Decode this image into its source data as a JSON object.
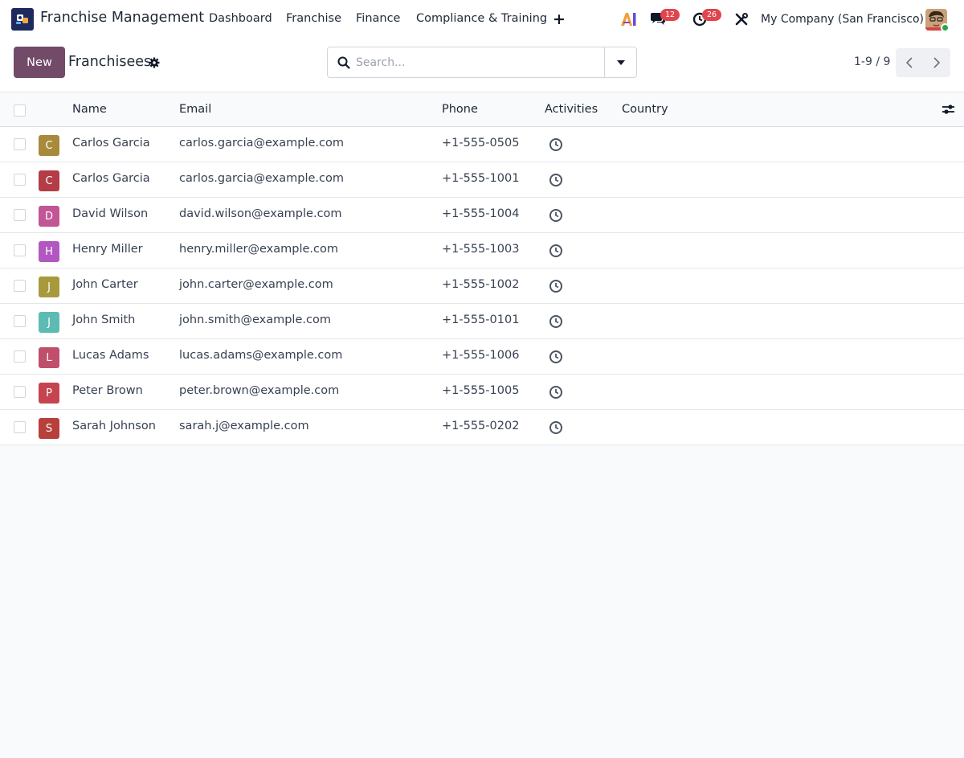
{
  "app": {
    "title": "Franchise Management"
  },
  "menu": [
    {
      "label": "Dashboard"
    },
    {
      "label": "Franchise"
    },
    {
      "label": "Finance"
    },
    {
      "label": "Compliance & Training"
    }
  ],
  "systray": {
    "ai_label": "AI",
    "messages_count": "12",
    "activities_count": "26",
    "company": "My Company (San Francisco)"
  },
  "control": {
    "new_label": "New",
    "title": "Franchisees",
    "search_placeholder": "Search...",
    "pager": "1-9 / 9"
  },
  "table": {
    "headers": {
      "name": "Name",
      "email": "Email",
      "phone": "Phone",
      "activities": "Activities",
      "country": "Country"
    },
    "rows": [
      {
        "initial": "C",
        "color": "#a78b3a",
        "name": "Carlos Garcia",
        "email": "carlos.garcia@example.com",
        "phone": "+1-555-0505"
      },
      {
        "initial": "C",
        "color": "#b43c46",
        "name": "Carlos Garcia",
        "email": "carlos.garcia@example.com",
        "phone": "+1-555-1001"
      },
      {
        "initial": "D",
        "color": "#c25595",
        "name": "David Wilson",
        "email": "david.wilson@example.com",
        "phone": "+1-555-1004"
      },
      {
        "initial": "H",
        "color": "#b257c1",
        "name": "Henry Miller",
        "email": "henry.miller@example.com",
        "phone": "+1-555-1003"
      },
      {
        "initial": "J",
        "color": "#a89a3c",
        "name": "John Carter",
        "email": "john.carter@example.com",
        "phone": "+1-555-1002"
      },
      {
        "initial": "J",
        "color": "#5cbcb4",
        "name": "John Smith",
        "email": "john.smith@example.com",
        "phone": "+1-555-0101"
      },
      {
        "initial": "L",
        "color": "#c04f6c",
        "name": "Lucas Adams",
        "email": "lucas.adams@example.com",
        "phone": "+1-555-1006"
      },
      {
        "initial": "P",
        "color": "#c5444f",
        "name": "Peter Brown",
        "email": "peter.brown@example.com",
        "phone": "+1-555-1005"
      },
      {
        "initial": "S",
        "color": "#b8403a",
        "name": "Sarah Johnson",
        "email": "sarah.j@example.com",
        "phone": "+1-555-0202"
      }
    ]
  },
  "colors": {
    "brand": "#714b67",
    "badge": "#e0454e",
    "online": "#28a745"
  }
}
